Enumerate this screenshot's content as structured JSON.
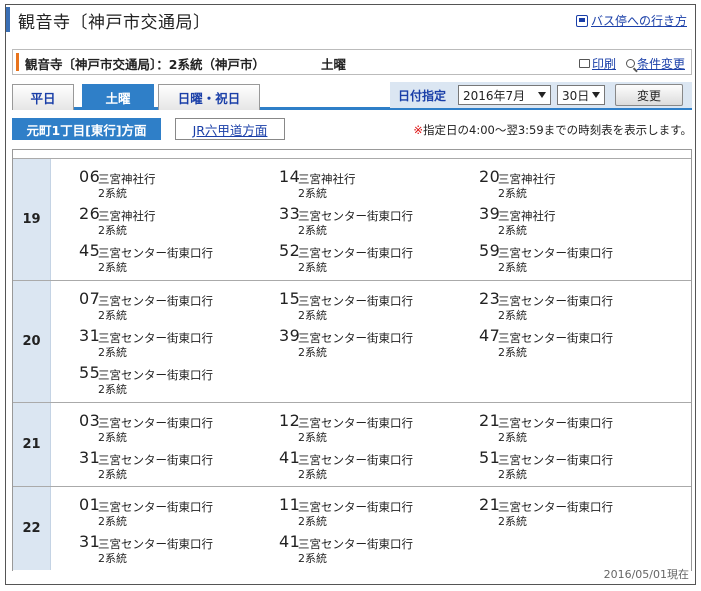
{
  "title": {
    "text": "観音寺〔神戸市交通局〕",
    "link_label": "バス停への行き方",
    "link_icon": "bus-stop-icon"
  },
  "subheader": {
    "title": "観音寺〔神戸市交通局〕：2系統（神戸市）",
    "day": "土曜",
    "print_label": "印刷",
    "print_icon": "printer-icon",
    "condition_label": "条件変更",
    "condition_icon": "search-icon"
  },
  "tabs": [
    {
      "label": "平日",
      "active": false
    },
    {
      "label": "土曜",
      "active": true
    },
    {
      "label": "日曜・祝日",
      "active": false
    }
  ],
  "date": {
    "label": "日付指定",
    "month": "2016年7月",
    "day": "30日",
    "change_label": "変更"
  },
  "directions": {
    "active": "元町1丁目[東行]方面",
    "other": "JR六甲道方面"
  },
  "notice": {
    "mark": "※",
    "text": "指定日の4:00〜翌3:59までの時刻表を表示します。"
  },
  "colors": {
    "accent_blue": "#2f7fc8",
    "hour_bg": "#dbe6f2",
    "link": "#1a3fa8",
    "subheader_accent": "#e8731c",
    "notice_mark": "#dd1111"
  },
  "timetable": [
    {
      "hour": "19",
      "departures": [
        {
          "min": "06",
          "dest": "三宮神社行",
          "route": "2系統"
        },
        {
          "min": "14",
          "dest": "三宮神社行",
          "route": "2系統"
        },
        {
          "min": "20",
          "dest": "三宮神社行",
          "route": "2系統"
        },
        {
          "min": "26",
          "dest": "三宮神社行",
          "route": "2系統"
        },
        {
          "min": "33",
          "dest": "三宮センター街東口行",
          "route": "2系統"
        },
        {
          "min": "39",
          "dest": "三宮神社行",
          "route": "2系統"
        },
        {
          "min": "45",
          "dest": "三宮センター街東口行",
          "route": "2系統"
        },
        {
          "min": "52",
          "dest": "三宮センター街東口行",
          "route": "2系統"
        },
        {
          "min": "59",
          "dest": "三宮センター街東口行",
          "route": "2系統"
        }
      ]
    },
    {
      "hour": "20",
      "departures": [
        {
          "min": "07",
          "dest": "三宮センター街東口行",
          "route": "2系統"
        },
        {
          "min": "15",
          "dest": "三宮センター街東口行",
          "route": "2系統"
        },
        {
          "min": "23",
          "dest": "三宮センター街東口行",
          "route": "2系統"
        },
        {
          "min": "31",
          "dest": "三宮センター街東口行",
          "route": "2系統"
        },
        {
          "min": "39",
          "dest": "三宮センター街東口行",
          "route": "2系統"
        },
        {
          "min": "47",
          "dest": "三宮センター街東口行",
          "route": "2系統"
        },
        {
          "min": "55",
          "dest": "三宮センター街東口行",
          "route": "2系統"
        }
      ]
    },
    {
      "hour": "21",
      "departures": [
        {
          "min": "03",
          "dest": "三宮センター街東口行",
          "route": "2系統"
        },
        {
          "min": "12",
          "dest": "三宮センター街東口行",
          "route": "2系統"
        },
        {
          "min": "21",
          "dest": "三宮センター街東口行",
          "route": "2系統"
        },
        {
          "min": "31",
          "dest": "三宮センター街東口行",
          "route": "2系統"
        },
        {
          "min": "41",
          "dest": "三宮センター街東口行",
          "route": "2系統"
        },
        {
          "min": "51",
          "dest": "三宮センター街東口行",
          "route": "2系統"
        }
      ]
    },
    {
      "hour": "22",
      "departures": [
        {
          "min": "01",
          "dest": "三宮センター街東口行",
          "route": "2系統"
        },
        {
          "min": "11",
          "dest": "三宮センター街東口行",
          "route": "2系統"
        },
        {
          "min": "21",
          "dest": "三宮センター街東口行",
          "route": "2系統"
        },
        {
          "min": "31",
          "dest": "三宮センター街東口行",
          "route": "2系統"
        },
        {
          "min": "41",
          "dest": "三宮センター街東口行",
          "route": "2系統"
        }
      ]
    }
  ],
  "footer": {
    "date": "2016/05/01現在"
  }
}
